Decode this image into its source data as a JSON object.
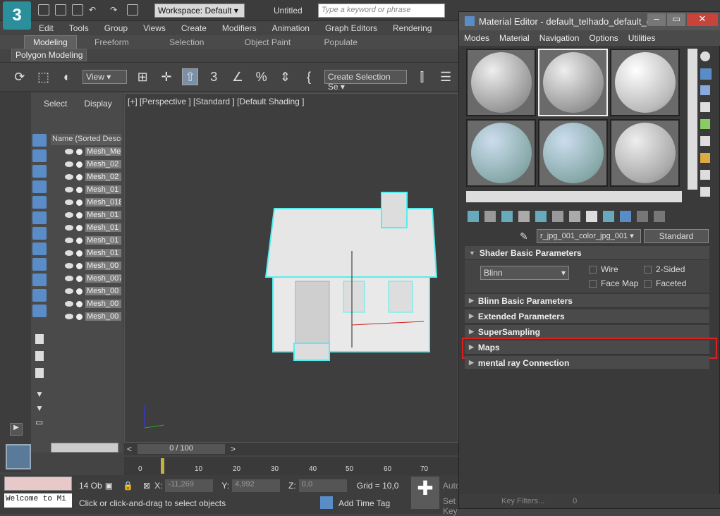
{
  "app": {
    "logo": "3",
    "workspace": "Workspace: Default",
    "doc_title": "Untitled",
    "search_placeholder": "Type a keyword or phrase"
  },
  "menu": [
    "Edit",
    "Tools",
    "Group",
    "Views",
    "Create",
    "Modifiers",
    "Animation",
    "Graph Editors",
    "Rendering"
  ],
  "ribbon": {
    "tabs": [
      "Modeling",
      "Freeform",
      "Selection",
      "Object Paint",
      "Populate"
    ],
    "active": "Modeling",
    "sub": "Polygon Modeling"
  },
  "toolbar": {
    "view_label": "View",
    "selection_set": "Create Selection Se"
  },
  "scene": {
    "tabs": [
      "Select",
      "Display"
    ],
    "header": "Name (Sorted Desce",
    "items": [
      "Mesh_Me",
      "Mesh_02",
      "Mesh_02",
      "Mesh_01",
      "Mesh_018",
      "Mesh_01",
      "Mesh_01",
      "Mesh_01",
      "Mesh_01",
      "Mesh_00",
      "Mesh_007",
      "Mesh_00",
      "Mesh_00",
      "Mesh_00"
    ]
  },
  "viewport": {
    "label": "[+] [Perspective ] [Standard ] [Default Shading ]"
  },
  "timeline": {
    "frame": "0 / 100",
    "ticks": [
      "0",
      "10",
      "20",
      "30",
      "40",
      "50",
      "60",
      "70"
    ]
  },
  "status": {
    "objects": "14 Ob",
    "x_label": "X:",
    "x_val": "-11,269",
    "y_label": "Y:",
    "y_val": "4,992",
    "z_label": "Z:",
    "z_val": "0,0",
    "grid": "Grid = 10,0",
    "prompt": "Click or click-and-drag to select objects",
    "listener": "Welcome to Mi",
    "add_time_tag": "Add Time Tag",
    "auto": "Auto",
    "set_key": "Set Key",
    "key_filters": "Key Filters...",
    "frame_field": "0"
  },
  "material_editor": {
    "title": "Material Editor - default_telhado_default_c...",
    "menu": [
      "Modes",
      "Material",
      "Navigation",
      "Options",
      "Utilities"
    ],
    "material_name": "r_jpg_001_color_jpg_001",
    "material_type": "Standard",
    "shader_section": "Shader Basic Parameters",
    "shader": "Blinn",
    "checkboxes": [
      "Wire",
      "2-Sided",
      "Face Map",
      "Faceted"
    ],
    "rollouts": [
      "Blinn Basic Parameters",
      "Extended Parameters",
      "SuperSampling",
      "Maps",
      "mental ray Connection"
    ]
  },
  "colors": {
    "highlight": "#e02020",
    "accent": "#2a8f9a"
  }
}
